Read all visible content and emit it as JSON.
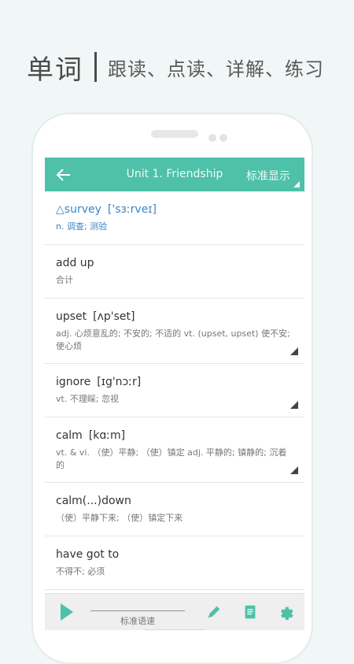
{
  "headline": {
    "title": "单词",
    "subtitle": "跟读、点读、详解、练习"
  },
  "app": {
    "header": {
      "back_icon": "back-arrow-icon",
      "title": "Unit 1. Friendship",
      "mode": "标准显示"
    },
    "words": [
      {
        "prefix": "△",
        "word": "survey",
        "phonetic": "['sɜːrveɪ]",
        "definition": "n. 调查; 测验",
        "active": true
      },
      {
        "word": "add up",
        "phonetic": "",
        "definition": "合计"
      },
      {
        "word": "upset",
        "phonetic": "[ʌp'set]",
        "definition": "adj. 心烦意乱的; 不安的; 不适的 vt. (upset, upset) 使不安; 使心烦"
      },
      {
        "word": "ignore",
        "phonetic": "[ɪg'nɔːr]",
        "definition": "vt. 不理睬; 忽视"
      },
      {
        "word": "calm",
        "phonetic": "[kɑːm]",
        "definition": "vt. & vi. （使）平静; （使）镇定 adj. 平静的; 镇静的; 沉着的"
      },
      {
        "word": "calm(...)down",
        "phonetic": "",
        "definition": "（使）平静下来; （使）镇定下来"
      },
      {
        "word": "have got to",
        "phonetic": "",
        "definition": "不得不; 必须"
      }
    ],
    "toolbar": {
      "speed_label": "标准语速",
      "play_icon": "play-icon",
      "edit_icon": "pencil-icon",
      "notes_icon": "notebook-icon",
      "settings_icon": "gear-icon"
    },
    "accent_color": "#4ec1a8"
  }
}
